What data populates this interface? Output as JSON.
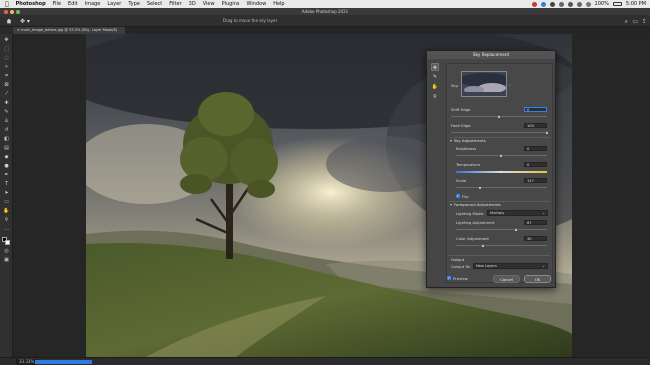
{
  "menubar": {
    "apple": "",
    "app": "Photoshop",
    "items": [
      "File",
      "Edit",
      "Image",
      "Layer",
      "Type",
      "Select",
      "Filter",
      "3D",
      "View",
      "Plugins",
      "Window",
      "Help"
    ],
    "battery": "100%",
    "clock": "5:00 PM"
  },
  "window": {
    "title": "Adobe Photoshop 2021"
  },
  "options": {
    "hint": "Drag to move the sky layer"
  },
  "document": {
    "tab": "main_image_before.jpg @ 33.3% (Sky, Layer Mask/8)"
  },
  "status": {
    "zoom": "33.33%",
    "progress": 1.0
  },
  "dialog": {
    "title": "Sky Replacement",
    "sky_label": "Sky:",
    "shift_edge_label": "Shift Edge",
    "shift_edge_value": "0",
    "shift_edge_level": 0.5,
    "fade_edge_label": "Fade Edge",
    "fade_edge_value": "100",
    "fade_edge_level": 1.0,
    "sky_adjustments": "Sky Adjustments",
    "brightness_label": "Brightness",
    "brightness_value": "0",
    "brightness_level": 0.5,
    "temperature_label": "Temperature",
    "temperature_value": "0",
    "temperature_level": 0.5,
    "scale_label": "Scale",
    "scale_value": "127",
    "scale_level": 0.27,
    "flip_label": "Flip",
    "foreground_adjustments": "Foreground Adjustments",
    "lighting_mode_label": "Lighting Mode:",
    "lighting_mode_value": "Multiply",
    "lighting_adjustment_label": "Lighting Adjustment",
    "lighting_adjustment_value": "67",
    "lighting_adjustment_level": 0.67,
    "color_adjustment_label": "Color Adjustment",
    "color_adjustment_value": "30",
    "color_adjustment_level": 0.3,
    "output_section": "Output",
    "output_to_label": "Output To:",
    "output_to_value": "New Layers",
    "preview_label": "Preview",
    "cancel_label": "Cancel",
    "ok_label": "OK"
  },
  "colors": {
    "accent": "#2d82f0",
    "dialog_bg": "#454545",
    "menubar_bg": "#e9e9e9",
    "app_bg": "#2a2a2a"
  }
}
